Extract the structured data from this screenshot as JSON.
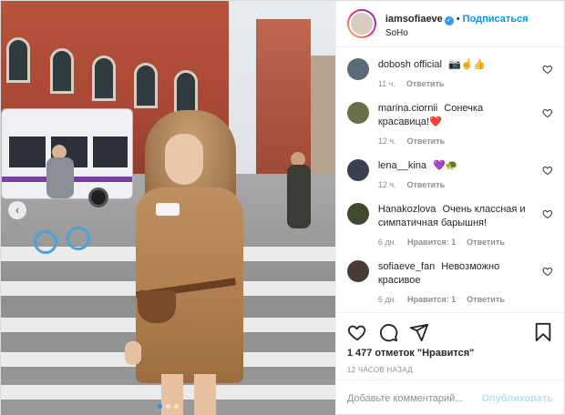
{
  "post": {
    "username": "iamsofiaeve",
    "follow_label": "Подписаться",
    "separator": "•",
    "location": "SoHo",
    "avatar_color": "#d8cbc0"
  },
  "comments": [
    {
      "username": "dobosh official",
      "text": "📷☝️👍",
      "time": "11 ч.",
      "reply": "Ответить",
      "likes": "",
      "avatar_color": "#5b6a7a"
    },
    {
      "username": "marina.ciornii",
      "text": "Сонечка красавица!❤️",
      "time": "12 ч.",
      "reply": "Ответить",
      "likes": "",
      "avatar_color": "#6a6f4a"
    },
    {
      "username": "lena__kina",
      "text": "💜🐢",
      "time": "12 ч.",
      "reply": "Ответить",
      "likes": "",
      "avatar_color": "#3b3f52"
    },
    {
      "username": "Hanakozlova",
      "text": "Очень классная и симпатичная барышня!",
      "time": "6 дн.",
      "likes": "Нравится: 1",
      "reply": "Ответить",
      "avatar_color": "#3f4b2c"
    },
    {
      "username": "sofiaeve_fan",
      "text": "Невозможно красивое",
      "time": "6 дн.",
      "likes": "Нравится: 1",
      "reply": "Ответить",
      "avatar_color": "#4a3b36"
    }
  ],
  "actions": {
    "likes_text": "1 477 отметок \"Нравится\"",
    "time_ago": "12 ЧАСОВ НАЗАД",
    "icons": [
      "heart-icon",
      "comment-icon",
      "share-icon",
      "bookmark-icon"
    ]
  },
  "add_comment": {
    "placeholder": "Добавьте комментарий...",
    "publish_label": "Опубликовать"
  },
  "carousel": {
    "slide_count": 3,
    "active_index": 0
  },
  "colors": {
    "accent": "#0095f6",
    "publish_disabled": "#b2dffc",
    "verified": "#3897f0"
  }
}
